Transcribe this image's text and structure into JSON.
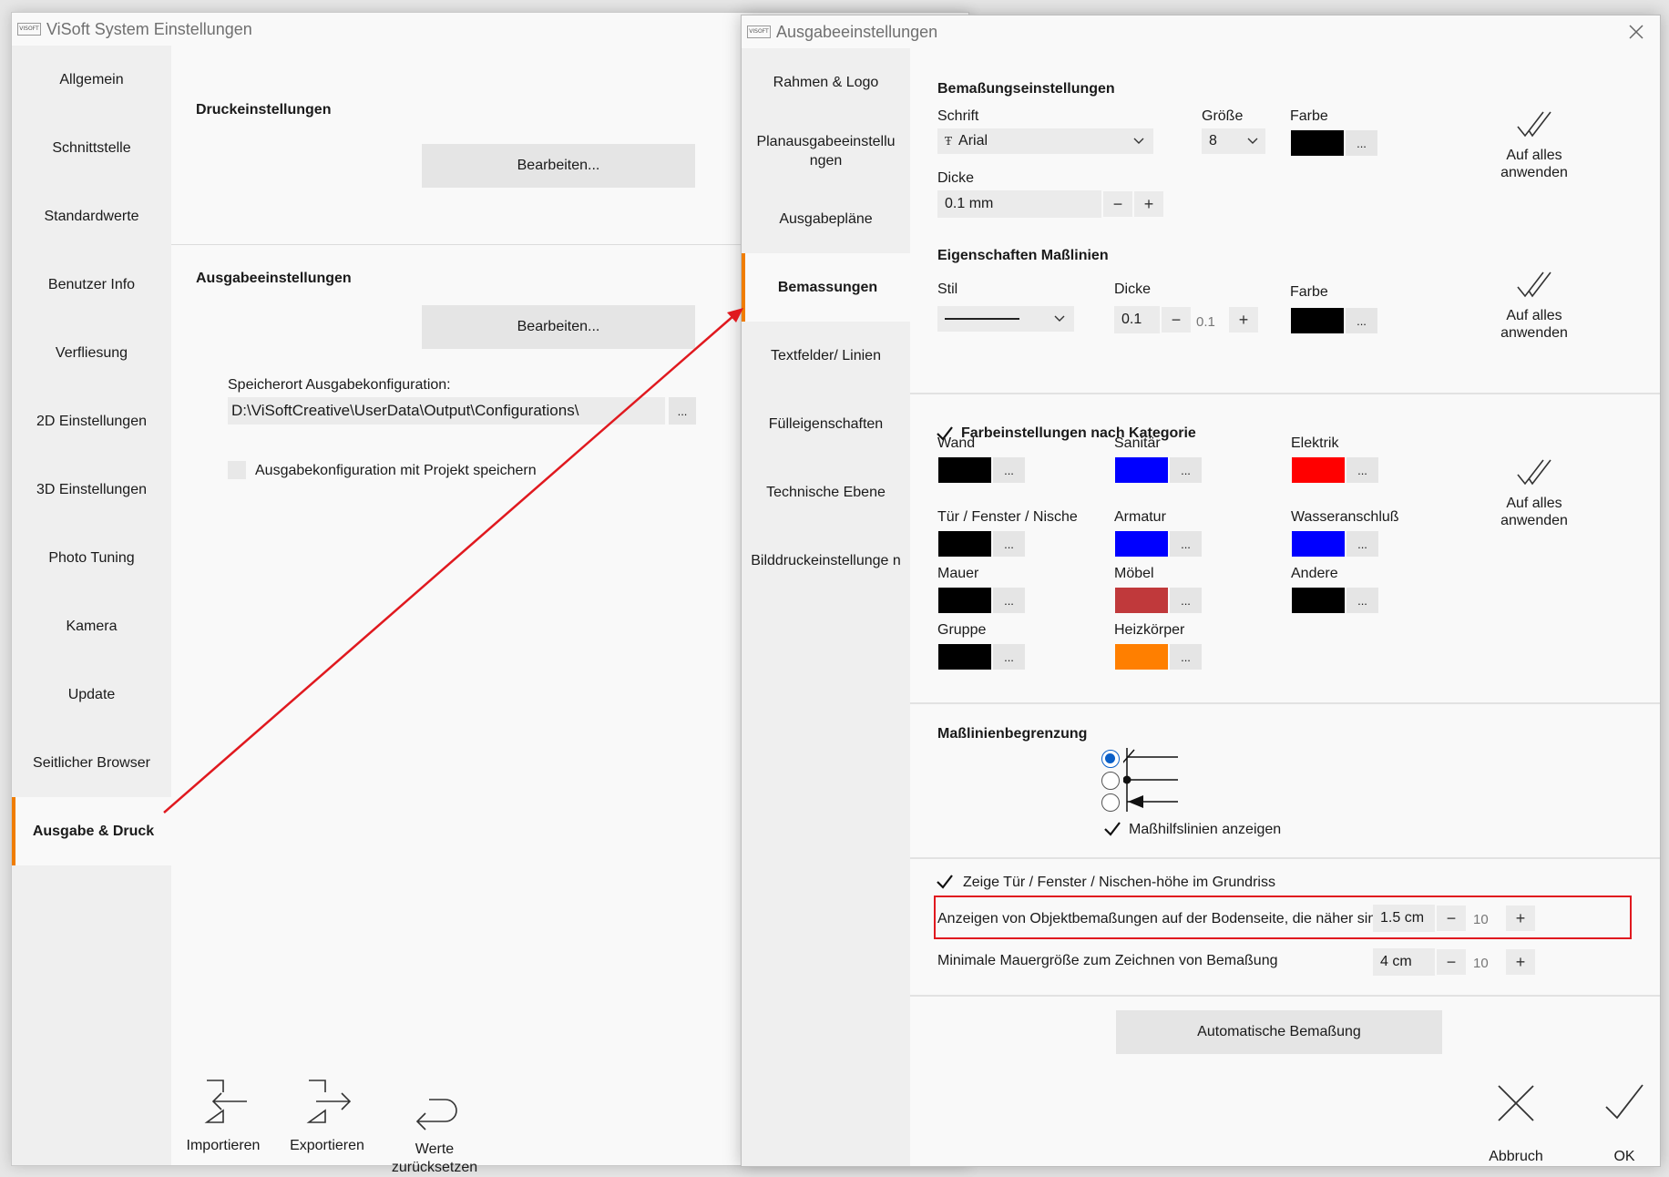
{
  "win1": {
    "title": "ViSoft System Einstellungen",
    "logo": "VISOFT",
    "nav": [
      "Allgemein",
      "Schnittstelle",
      "Standardwerte",
      "Benutzer Info",
      "Verfliesung",
      "2D Einstellungen",
      "3D Einstellungen",
      "Photo Tuning",
      "Kamera",
      "Update",
      "Seitlicher Browser",
      "Ausgabe & Druck"
    ],
    "active_nav": "Ausgabe & Druck",
    "print_title": "Druckeinstellungen",
    "print_btn": "Bearbeiten...",
    "output_title": "Ausgabeeinstellungen",
    "output_btn": "Bearbeiten...",
    "path_label": "Speicherort Ausgabekonfiguration:",
    "path_value": "D:\\ViSoftCreative\\UserData\\Output\\Configurations\\",
    "path_browse": "...",
    "save_with_project": "Ausgabekonfiguration mit Projekt speichern",
    "actions": {
      "import": "Importieren",
      "export": "Exportieren",
      "reset_line1": "Werte",
      "reset_line2": "zurücksetzen"
    }
  },
  "win2": {
    "title": "Ausgabeeinstellungen",
    "logo": "VISOFT",
    "nav": [
      "Rahmen & Logo",
      "Planausgabeeinstellu ngen",
      "Ausgabepläne",
      "Bemassungen",
      "Textfelder/ Linien",
      "Fülleigenschaften",
      "Technische Ebene",
      "Bilddruckeinstellunge n"
    ],
    "active_nav": "Bemassungen",
    "dim": {
      "title": "Bemaßungseinstellungen",
      "font_label": "Schrift",
      "font_value": "Arial",
      "size_label": "Größe",
      "size_value": "8",
      "color_label": "Farbe",
      "thickness_label": "Dicke",
      "thickness_value": "0.1 mm",
      "apply_line1": "Auf alles",
      "apply_line2": "anwenden"
    },
    "lines": {
      "title": "Eigenschaften Maßlinien",
      "style_label": "Stil",
      "thickness_label": "Dicke",
      "thickness_value": "0.1",
      "thickness_step": "0.1",
      "color_label": "Farbe",
      "apply_line1": "Auf alles",
      "apply_line2": "anwenden"
    },
    "categories": {
      "title": "Farbeinstellungen nach Kategorie",
      "apply_line1": "Auf alles",
      "apply_line2": "anwenden",
      "items": [
        {
          "label": "Wand",
          "color": "#000000"
        },
        {
          "label": "Sanitär",
          "color": "#0000ff"
        },
        {
          "label": "Elektrik",
          "color": "#ff0000"
        },
        {
          "label": "Tür / Fenster / Nische",
          "color": "#000000"
        },
        {
          "label": "Armatur",
          "color": "#0000ff"
        },
        {
          "label": "Wasseranschluß",
          "color": "#0000ff"
        },
        {
          "label": "Mauer",
          "color": "#000000"
        },
        {
          "label": "Möbel",
          "color": "#c0393b"
        },
        {
          "label": "Andere",
          "color": "#000000"
        },
        {
          "label": "Gruppe",
          "color": "#000000"
        },
        {
          "label": "Heizkörper",
          "color": "#ff7f00"
        }
      ]
    },
    "limit": {
      "title": "Maßlinienbegrenzung",
      "helper_lines": "Maßhilfslinien anzeigen"
    },
    "options": {
      "show_height": "Zeige Tür / Fenster / Nischen-höhe im Grundriss",
      "object_dims_label": "Anzeigen von Objektbemaßungen auf der Bodenseite, die näher sind als",
      "object_dims_value": "1.5 cm",
      "object_dims_step": "10",
      "min_wall_label": "Minimale Mauergröße zum Zeichnen von Bemaßung",
      "min_wall_value": "4 cm",
      "min_wall_step": "10"
    },
    "auto_btn": "Automatische Bemaßung",
    "cancel": "Abbruch",
    "ok": "OK",
    "minus": "−",
    "plus": "+",
    "dots": "..."
  },
  "colors": {
    "accent": "#f07d00",
    "highlight_box": "#e0191f",
    "arrow": "#e0191f",
    "radio": "#0a5fc8"
  }
}
